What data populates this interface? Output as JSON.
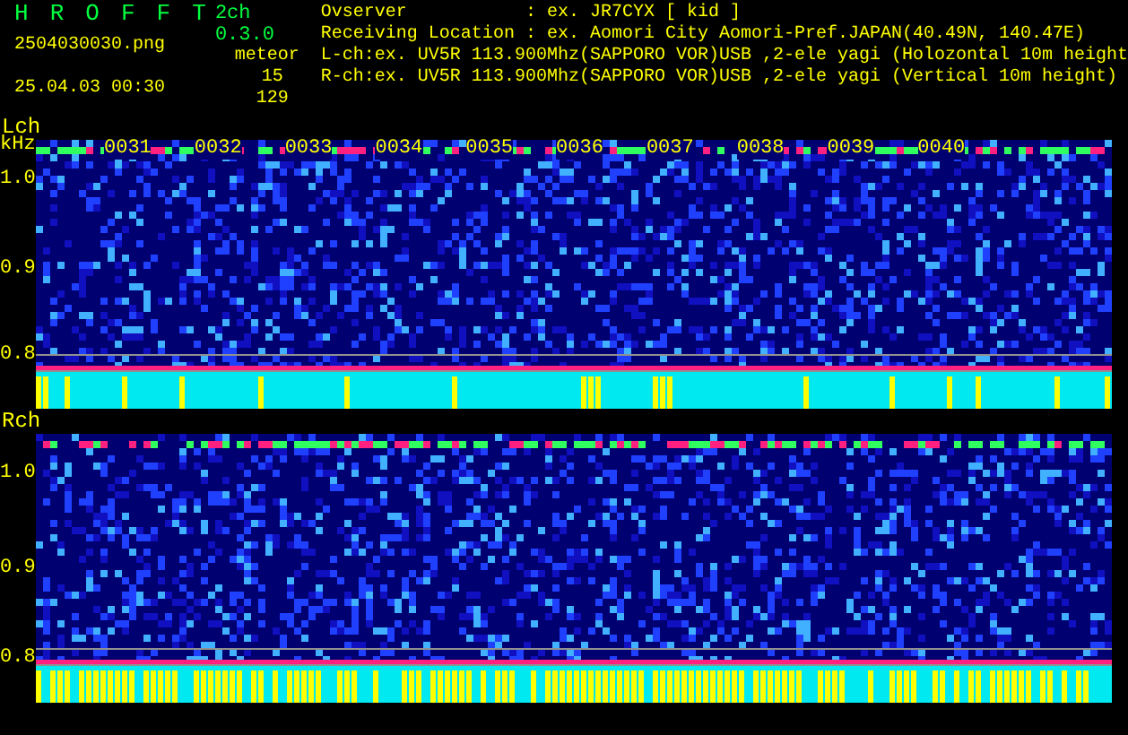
{
  "header": {
    "title_letters": [
      "H",
      "R",
      "O",
      "F",
      "F",
      "T"
    ],
    "version": "2ch 0.3.0",
    "filename": "2504030030.png",
    "datetime": "25.04.03 00:30",
    "meteor_label": "meteor",
    "counts": [
      "15",
      "129"
    ],
    "info": [
      "Ovserver           : ex. JR7CYX [ kid ]",
      "Receiving Location : ex. Aomori City Aomori-Pref.JAPAN(40.49N, 140.47E)",
      "L-ch:ex. UV5R 113.900Mhz(SAPPORO VOR)USB ,2-ele yagi (Holozontal 10m height",
      "R-ch:ex. UV5R 113.900Mhz(SAPPORO VOR)USB ,2-ele yagi (Vertical 10m height)"
    ]
  },
  "channels": [
    {
      "label": "Lch",
      "unit": "kHz",
      "ticks": [
        "1.0",
        "0.9",
        "0.8"
      ],
      "time_labels": [
        "0031",
        "0032",
        "0033",
        "0034",
        "0035",
        "0036",
        "0037",
        "0038",
        "0039",
        "0040"
      ]
    },
    {
      "label": "Rch",
      "ticks": [
        "1.0",
        "0.9",
        "0.8"
      ]
    }
  ]
}
